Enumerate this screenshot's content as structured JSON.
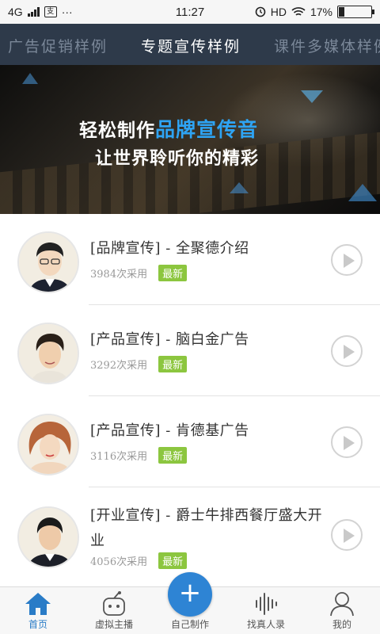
{
  "status_bar": {
    "network": "4G",
    "time": "11:27",
    "hd": "HD",
    "battery": "17%",
    "battery_level": 0.17,
    "app_icon_char": "支",
    "dots": "···"
  },
  "tabs": [
    {
      "label": "广告促销样例",
      "active": false
    },
    {
      "label": "专题宣传样例",
      "active": true
    },
    {
      "label": "课件多媒体样例",
      "active": false
    }
  ],
  "banner": {
    "line1_prefix": "轻松制作",
    "line1_highlight": "品牌宣传音",
    "line2": "让世界聆听你的精彩"
  },
  "items": [
    {
      "title": "[品牌宣传] - 全聚德介绍",
      "count": "3984次采用",
      "badge": "最新",
      "avatar_icon": "man-glasses-avatar"
    },
    {
      "title": "[产品宣传] - 脑白金广告",
      "count": "3292次采用",
      "badge": "最新",
      "avatar_icon": "young-man-avatar"
    },
    {
      "title": "[产品宣传] - 肯德基广告",
      "count": "3116次采用",
      "badge": "最新",
      "avatar_icon": "woman-avatar"
    },
    {
      "title": "[开业宣传] - 爵士牛排西餐厅盛大开业",
      "count": "4056次采用",
      "badge": "最新",
      "avatar_icon": "man-suit-avatar"
    }
  ],
  "bottom_nav": [
    {
      "label": "首页",
      "icon": "home-icon",
      "active": true
    },
    {
      "label": "虚拟主播",
      "icon": "robot-icon",
      "active": false
    },
    {
      "label": "自己制作",
      "icon": "plus-icon",
      "active": false
    },
    {
      "label": "找真人录",
      "icon": "voice-wave-icon",
      "active": false
    },
    {
      "label": "我的",
      "icon": "user-icon",
      "active": false
    }
  ],
  "fab": {
    "symbol": "+"
  },
  "colors": {
    "accent": "#2e84d4",
    "tab_bg": "#2e3a4a",
    "badge": "#8cc63f",
    "highlight": "#2ea4f4"
  }
}
